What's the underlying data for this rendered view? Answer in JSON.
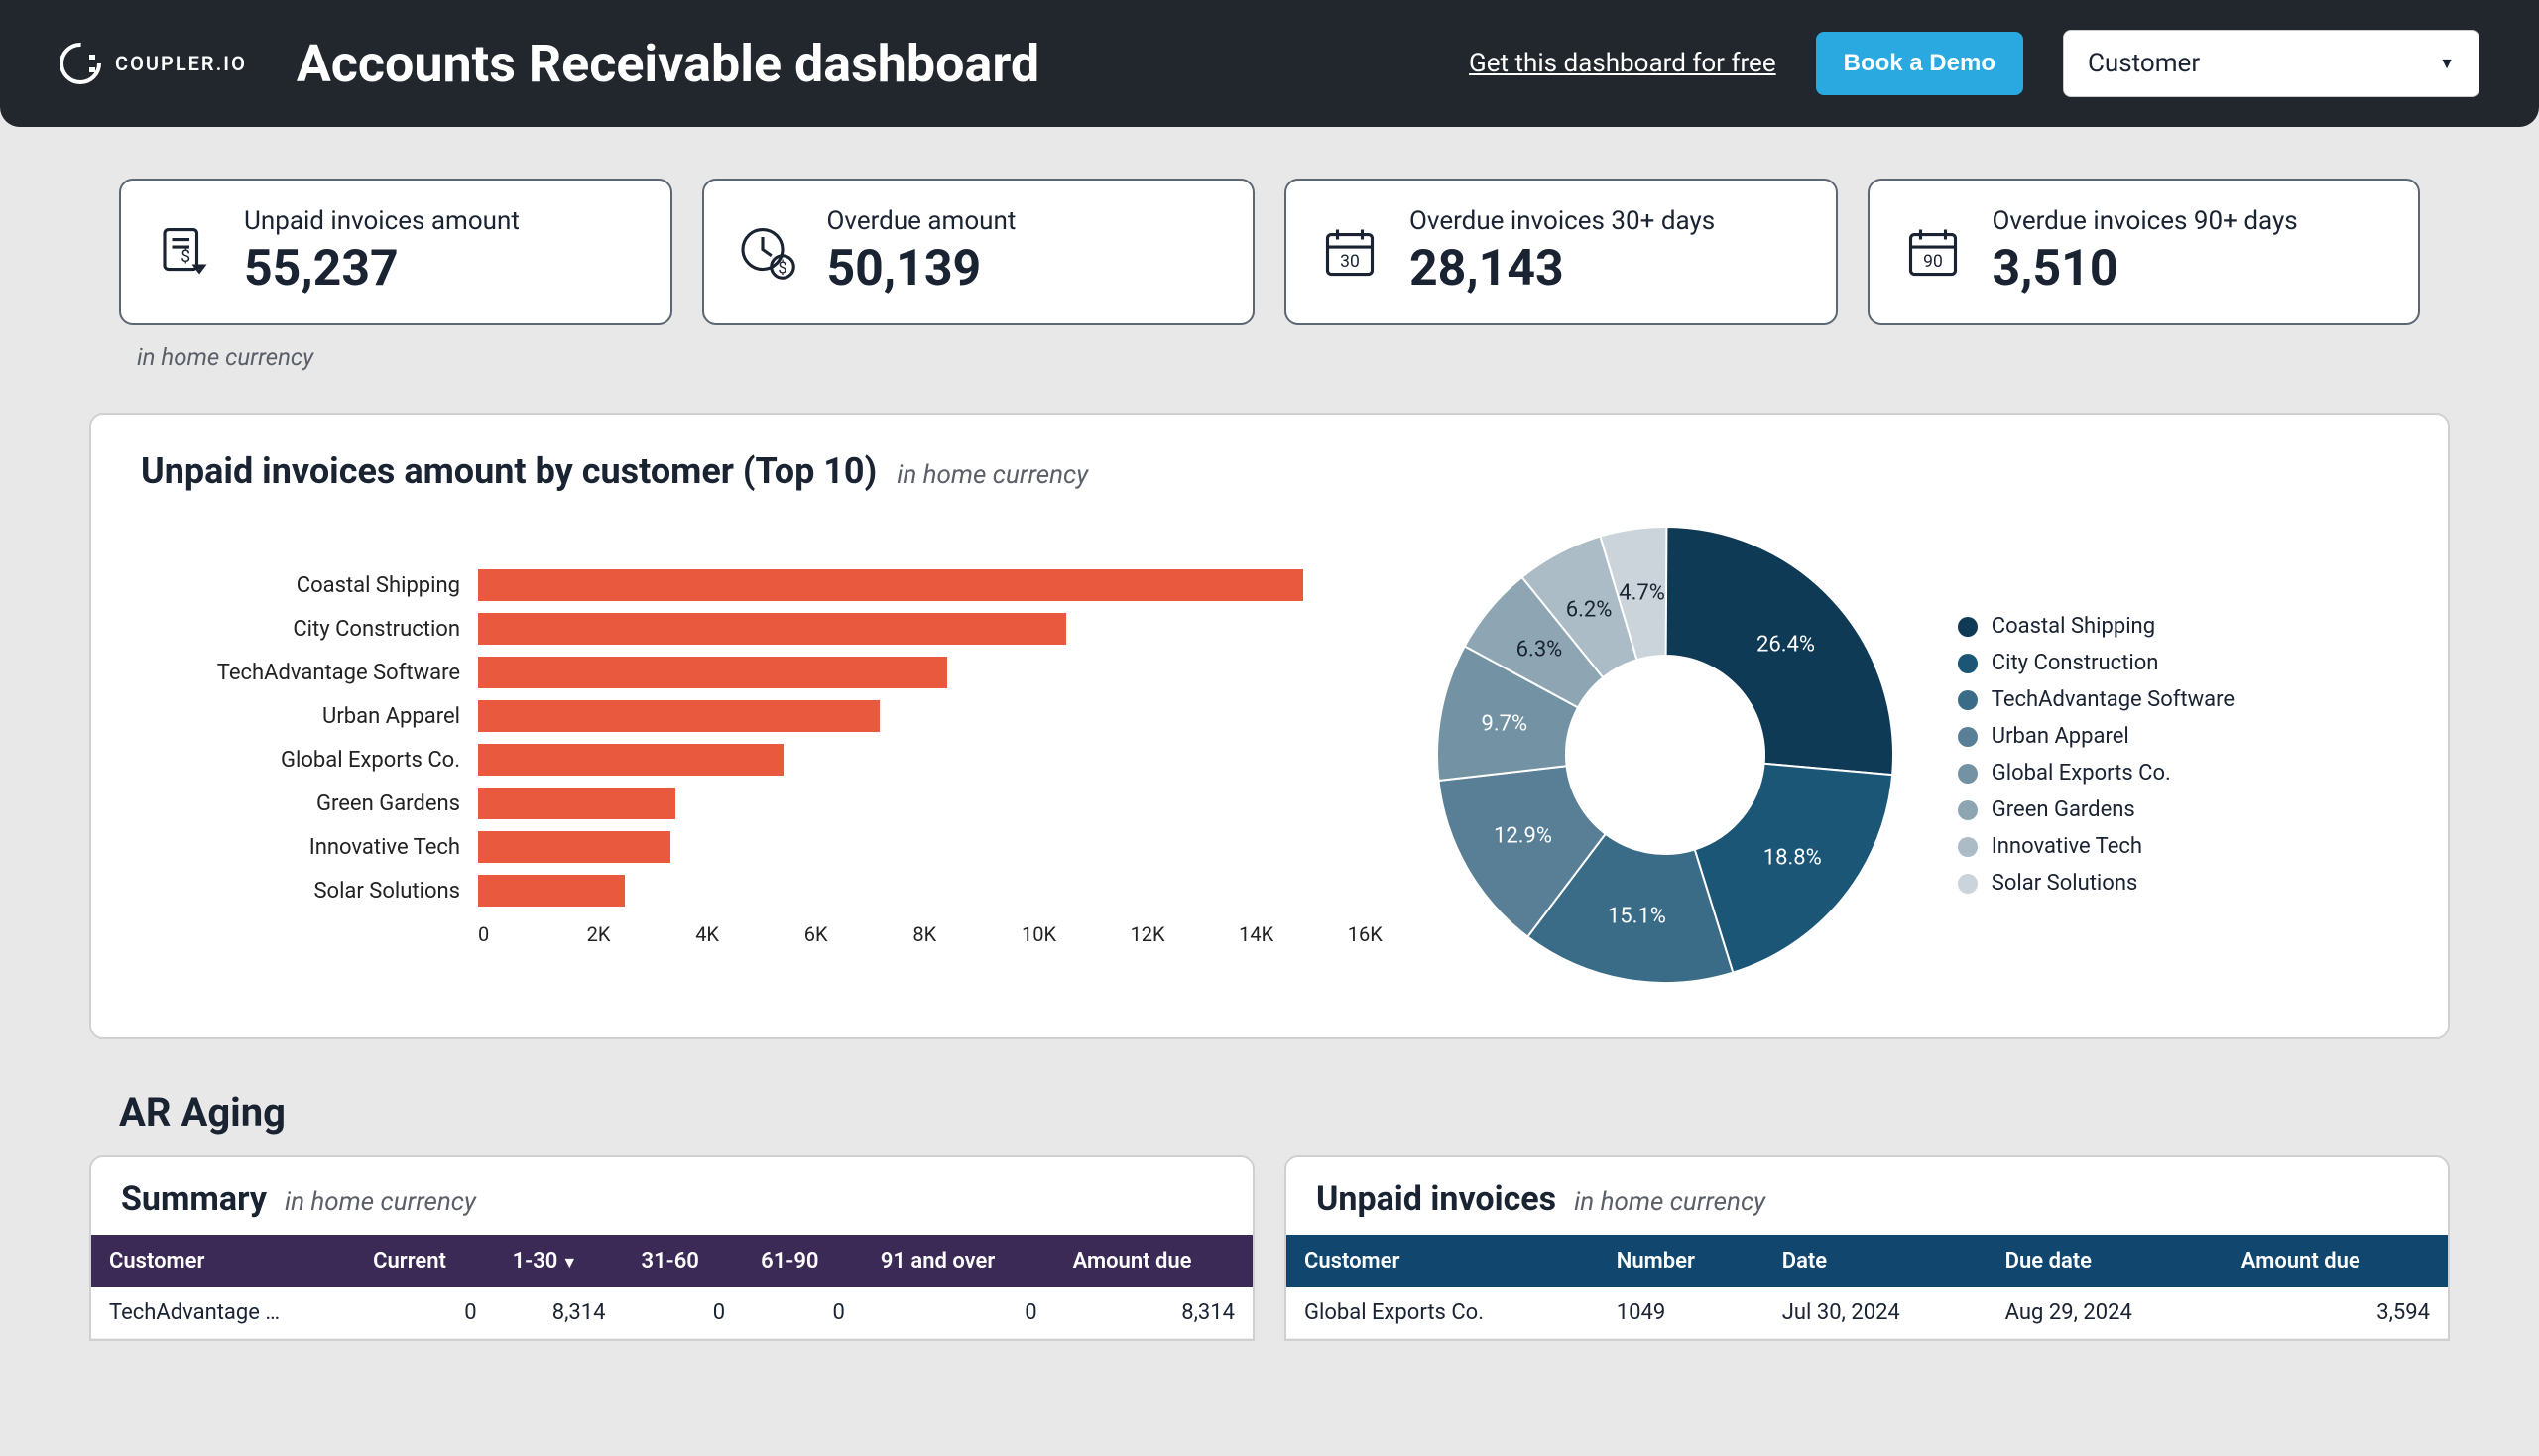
{
  "brand": {
    "name": "COUPLER.IO"
  },
  "header": {
    "title": "Accounts Receivable dashboard",
    "get_link": "Get this dashboard for free",
    "demo_btn": "Book a Demo",
    "customer_select": "Customer"
  },
  "kpis": {
    "unpaid": {
      "label": "Unpaid invoices amount",
      "value": "55,237"
    },
    "overdue": {
      "label": "Overdue amount",
      "value": "50,139"
    },
    "over30": {
      "label": "Overdue invoices 30+ days",
      "value": "28,143"
    },
    "over90": {
      "label": "Overdue invoices 90+ days",
      "value": "3,510"
    },
    "currency_note": "in home currency"
  },
  "chart_section": {
    "title": "Unpaid invoices amount by customer (Top 10)",
    "sub": "in home currency"
  },
  "chart_data": [
    {
      "type": "bar",
      "title": "Unpaid invoices amount by customer (Top 10)",
      "orientation": "horizontal",
      "xlabel": "",
      "ylabel": "",
      "xlim": [
        0,
        16000
      ],
      "tick_labels": [
        "0",
        "2K",
        "4K",
        "6K",
        "8K",
        "10K",
        "12K",
        "14K",
        "16K"
      ],
      "categories": [
        "Coastal Shipping",
        "City Construction",
        "TechAdvantage Software",
        "Urban Apparel",
        "Global Exports Co.",
        "Green Gardens",
        "Innovative Tech",
        "Solar Solutions"
      ],
      "values": [
        14600,
        10400,
        8300,
        7100,
        5400,
        3500,
        3400,
        2600
      ]
    },
    {
      "type": "pie",
      "title": "Unpaid invoices share by customer",
      "series": [
        {
          "name": "Coastal Shipping",
          "percent": 26.4,
          "color": "#0f3a55"
        },
        {
          "name": "City Construction",
          "percent": 18.8,
          "color": "#1b5676"
        },
        {
          "name": "TechAdvantage Software",
          "percent": 15.1,
          "color": "#3a6c87"
        },
        {
          "name": "Urban Apparel",
          "percent": 12.9,
          "color": "#587f95"
        },
        {
          "name": "Global Exports Co.",
          "percent": 9.7,
          "color": "#7392a4"
        },
        {
          "name": "Green Gardens",
          "percent": 6.3,
          "color": "#8ea6b4"
        },
        {
          "name": "Innovative Tech",
          "percent": 6.2,
          "color": "#abbcc6"
        },
        {
          "name": "Solar Solutions",
          "percent": 4.7,
          "color": "#cad4da"
        }
      ]
    }
  ],
  "aging": {
    "heading": "AR Aging",
    "summary": {
      "title": "Summary",
      "sub": "in home currency",
      "columns": [
        "Customer",
        "Current",
        "1-30",
        "31-60",
        "61-90",
        "91 and over",
        "Amount due"
      ],
      "sorted_col": 2,
      "rows": [
        {
          "customer": "TechAdvantage …",
          "current": "0",
          "c1": "8,314",
          "c2": "0",
          "c3": "0",
          "c4": "0",
          "due": "8,314"
        }
      ]
    },
    "unpaid": {
      "title": "Unpaid invoices",
      "sub": "in home currency",
      "columns": [
        "Customer",
        "Number",
        "Date",
        "Due date",
        "Amount due"
      ],
      "rows": [
        {
          "customer": "Global Exports Co.",
          "number": "1049",
          "date": "Jul 30, 2024",
          "due_date": "Aug 29, 2024",
          "amount": "3,594"
        }
      ]
    }
  }
}
